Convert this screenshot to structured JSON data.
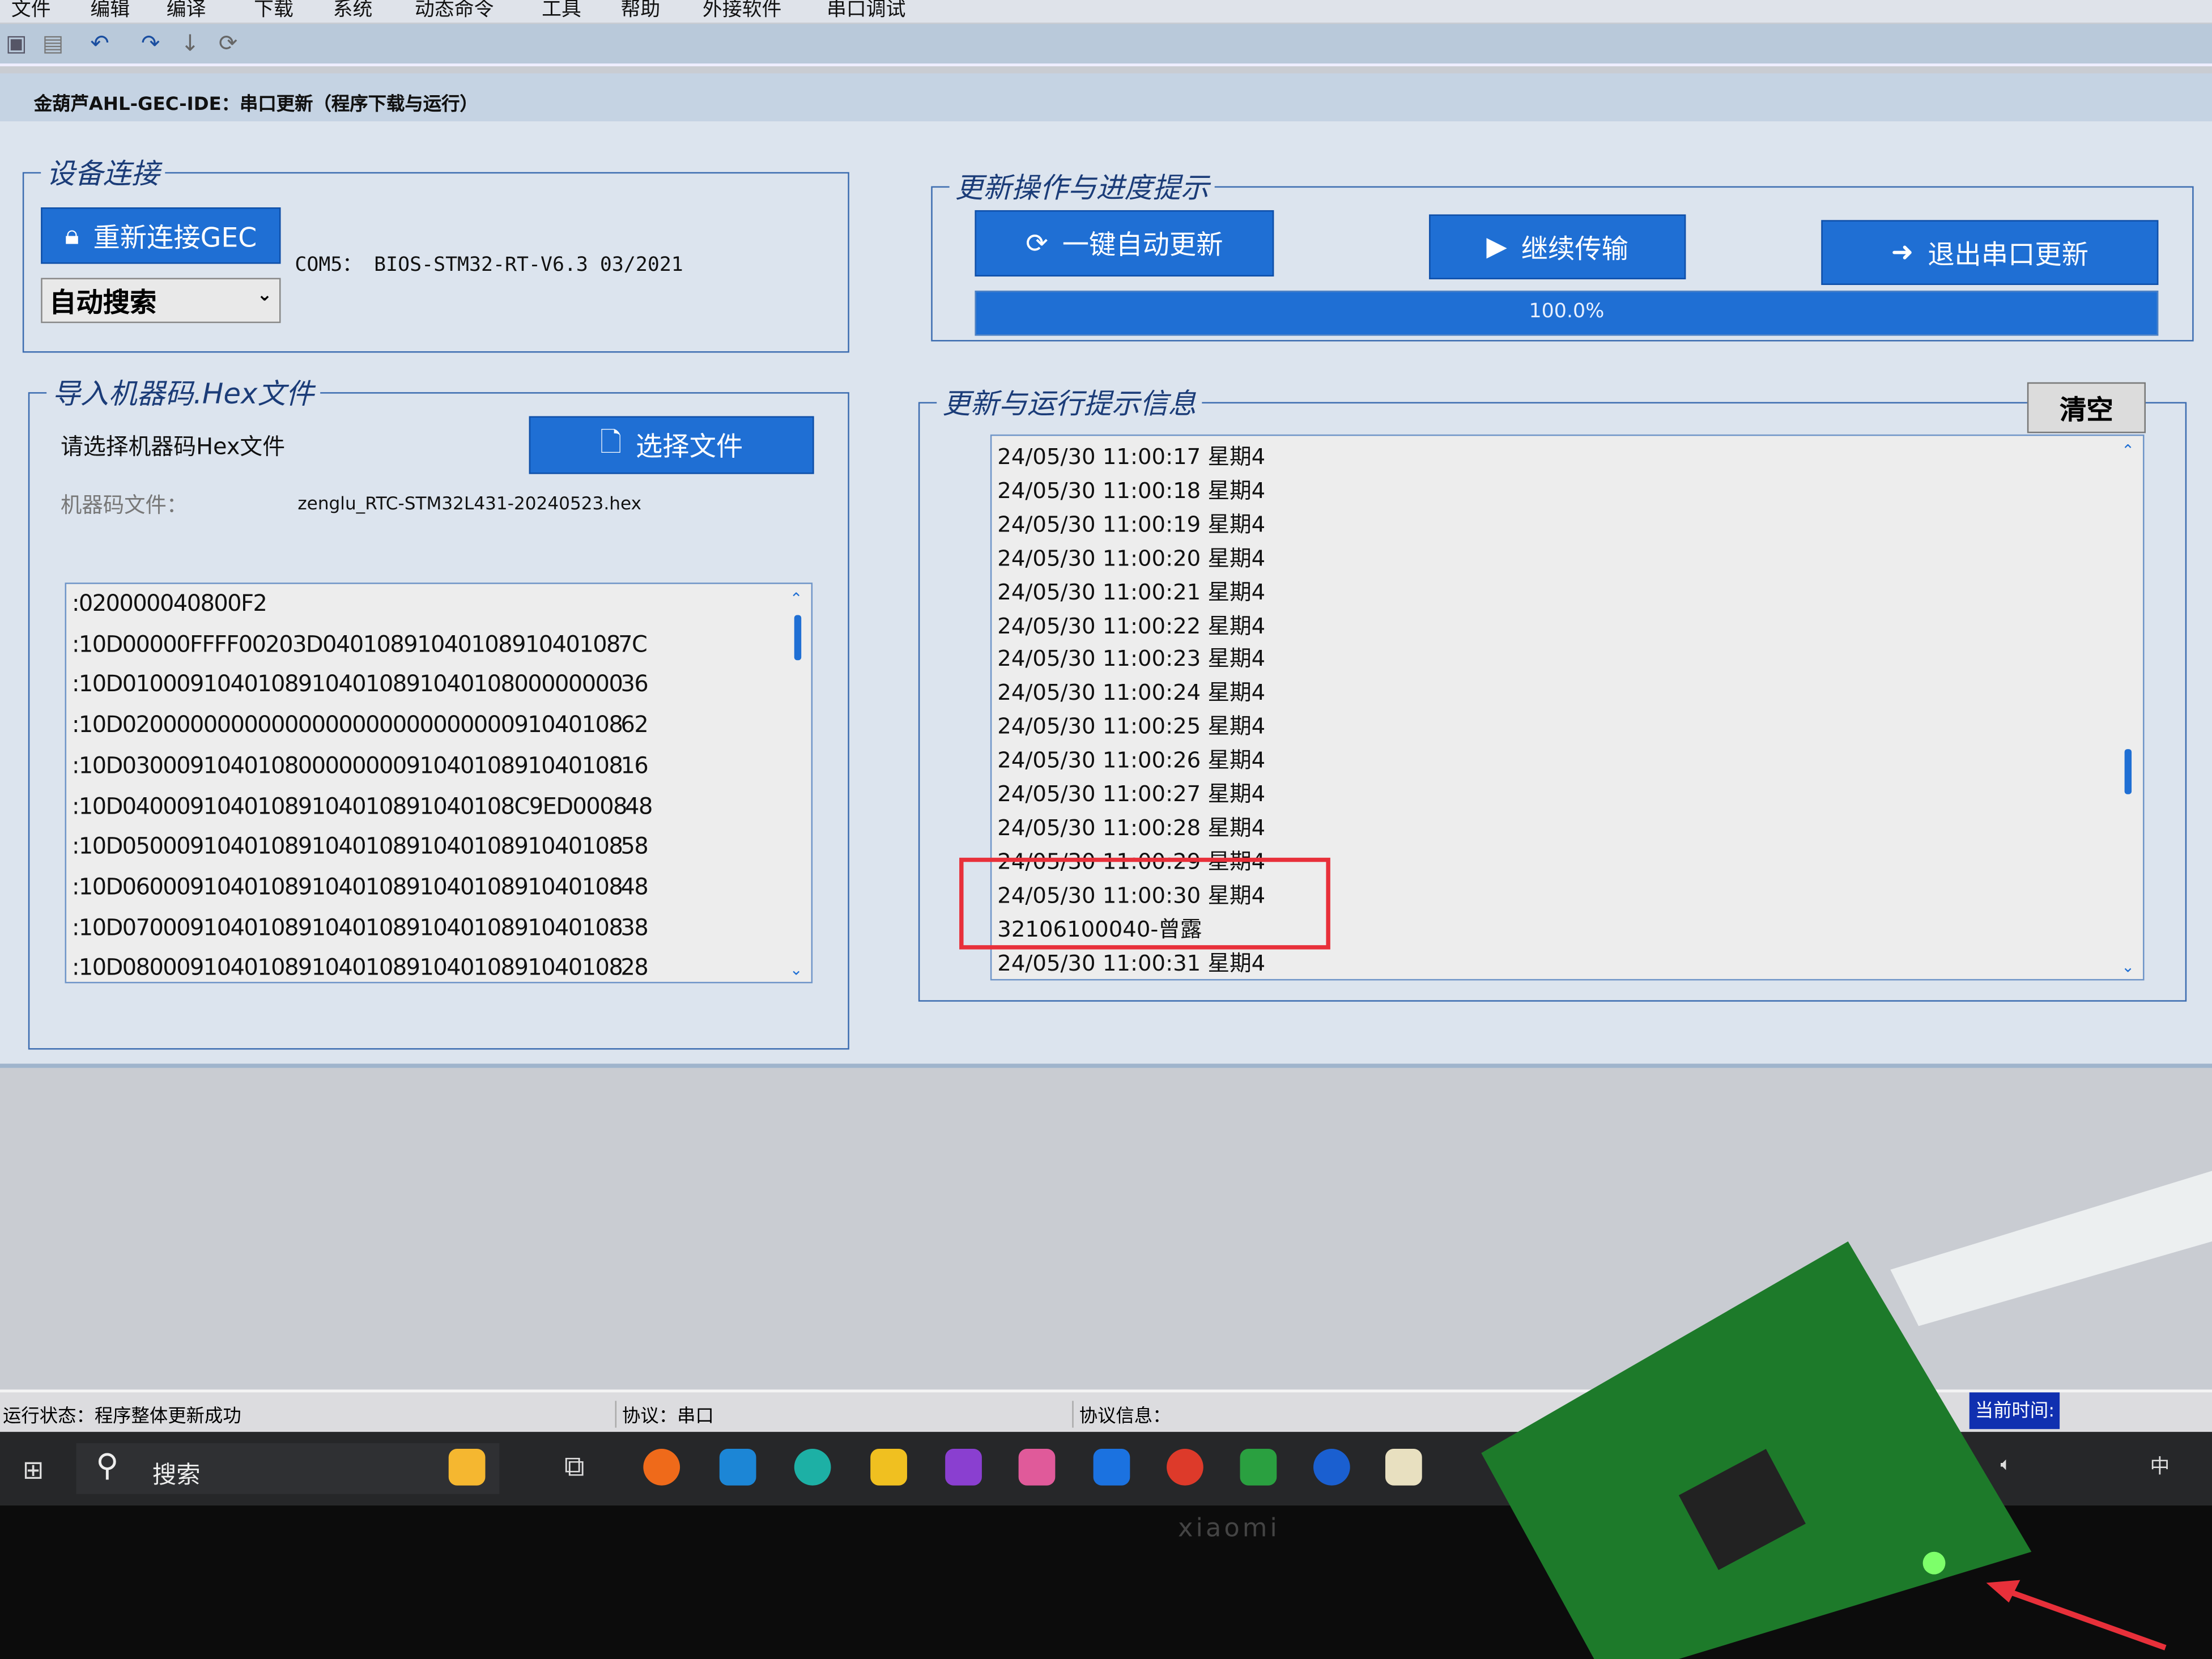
{
  "menu": [
    "文件",
    "编辑",
    "编译",
    "下载",
    "系统",
    "动态命令",
    "工具",
    "帮助",
    "外接软件",
    "串口调试"
  ],
  "window_title": "金葫芦AHL-GEC-IDE：串口更新（程序下载与运行）",
  "device": {
    "legend": "设备连接",
    "reconnect": "重新连接GEC",
    "com_info": "COM5：  BIOS-STM32-RT-V6.3 03/2021",
    "port_select": "自动搜索"
  },
  "hex": {
    "legend": "导入机器码.Hex文件",
    "prompt": "请选择机器码Hex文件",
    "select_button": "选择文件",
    "file_label": "机器码文件：",
    "file_name": "zenglu_RTC-STM32L431-20240523.hex",
    "lines": [
      ":020000040800F2",
      ":10D00000FFFF00203D0401089104010891040108 7C",
      ":10D0100091040108910401089104010800000000 36",
      ":10D0200000000000000000000000000091040108 62",
      ":10D0300091040108000000009104010891040108 16",
      ":10D04000910401089104010891040108C9ED0008 48",
      ":10D0500091040108910401089104010891040108 58",
      ":10D0600091040108910401089104010891040108 48",
      ":10D0700091040108910401089104010891040108 38",
      ":10D0800091040108910401089104010891040108 28"
    ]
  },
  "update": {
    "legend": "更新操作与进度提示",
    "auto_update": "一键自动更新",
    "continue": "继续传输",
    "exit": "退出串口更新",
    "progress_text": "100.0%",
    "progress": 100
  },
  "log": {
    "legend": "更新与运行提示信息",
    "clear": "清空",
    "lines": [
      "24/05/30 11:00:17 星期4",
      "24/05/30 11:00:18 星期4",
      "24/05/30 11:00:19 星期4",
      "24/05/30 11:00:20 星期4",
      "24/05/30 11:00:21 星期4",
      "24/05/30 11:00:22 星期4",
      "24/05/30 11:00:23 星期4",
      "24/05/30 11:00:24 星期4",
      "24/05/30 11:00:25 星期4",
      "24/05/30 11:00:26 星期4",
      "24/05/30 11:00:27 星期4",
      "24/05/30 11:00:28 星期4",
      "24/05/30 11:00:29 星期4",
      "24/05/30 11:00:30 星期4",
      "32106100040-曾露",
      "24/05/30 11:00:31 星期4"
    ]
  },
  "status": {
    "run": "运行状态：程序整体更新成功",
    "protocol": "协议：串口",
    "protocol_info": "协议信息：",
    "time_label": "当前时间:"
  },
  "taskbar": {
    "search": "搜索",
    "ime": "中",
    "brand": "xiaomi"
  },
  "colors": {
    "accent": "#1f6fd4",
    "highlight": "#e8303a"
  }
}
